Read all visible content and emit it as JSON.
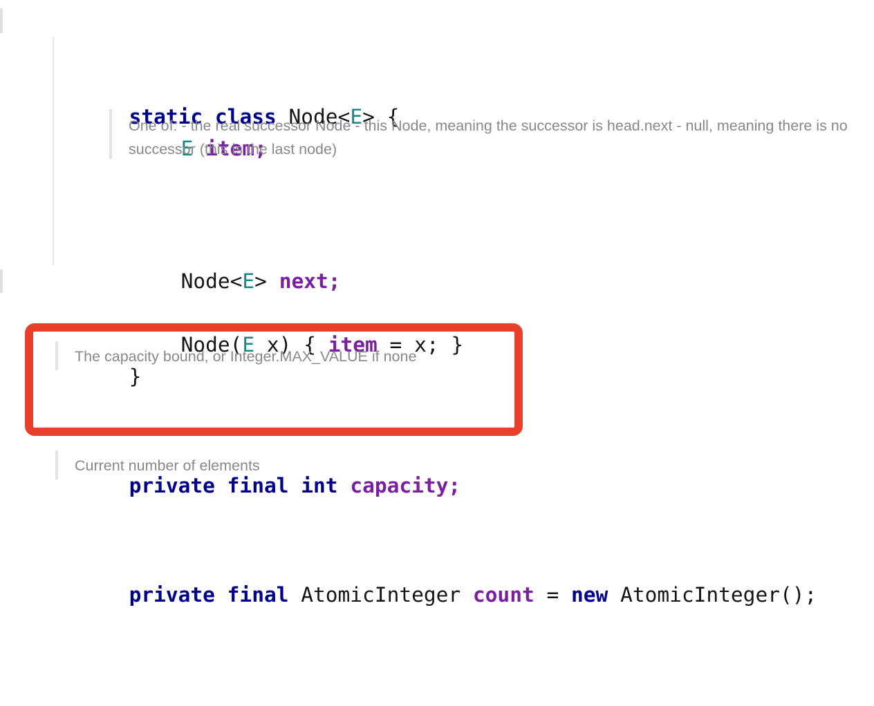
{
  "editor": {
    "background_color": "#FFFFFF",
    "font_size_code_px": 29.5,
    "font_size_comment_px": 21.5
  },
  "theme": {
    "keyword_color": "#00008B",
    "type_param_color": "#17878A",
    "field_color": "#7B1FA2",
    "plain_text_color": "#141414",
    "comment_color": "#888888",
    "comment_bar_color": "#E3E3E3",
    "indent_guide_color": "#E6E6E6",
    "highlight_color": "#E8402A"
  },
  "code": {
    "line_1": {
      "indent": "",
      "kw_static": "static",
      "space_1": " ",
      "kw_class": "class",
      "space_2": " ",
      "name": "Node<",
      "type_param": "E",
      "tail": "> {",
      "full_text": "static class Node<E> {"
    },
    "line_2": {
      "type_param": "E",
      "space": " ",
      "field": "item",
      "tail": ";",
      "full_text": "E item;"
    },
    "line_3": {
      "head": "Node<",
      "type_param": "E",
      "mid": "> ",
      "field": "next",
      "tail": ";",
      "full_text": "Node<E> next;"
    },
    "line_4": {
      "head": "Node(",
      "type_param": "E",
      "mid": " x) { ",
      "field": "item",
      "tail": " = x; }",
      "full_text": "Node(E x) { item = x; }"
    },
    "line_5": {
      "full_text": "}"
    },
    "line_capacity": {
      "kw_private": "private",
      "space_1": " ",
      "kw_final": "final",
      "space_2": " ",
      "kw_int": "int",
      "space_3": " ",
      "field": "capacity",
      "tail": ";",
      "full_text": "private final int capacity;"
    },
    "line_count": {
      "kw_private": "private",
      "space_1": " ",
      "kw_final": "final",
      "space_2": " ",
      "type": " AtomicInteger ",
      "field": "count",
      "equals": " = ",
      "kw_new": "new",
      "tail": " AtomicInteger();",
      "full_text": "private final AtomicInteger count = new AtomicInteger();"
    }
  },
  "comments": {
    "node_next_doc": "One of: - the real successor Node - this Node, meaning the successor is head.next - null, meaning there is no successor (this is the last node)",
    "capacity_doc": "The capacity bound, or Integer.MAX_VALUE if none",
    "count_doc": "Current number of elements"
  },
  "annotation": {
    "highlight_border_color": "#E8402A",
    "highlight_border_width_px": 12,
    "highlight_radius_px": 14,
    "target_text": "private final int capacity;"
  }
}
